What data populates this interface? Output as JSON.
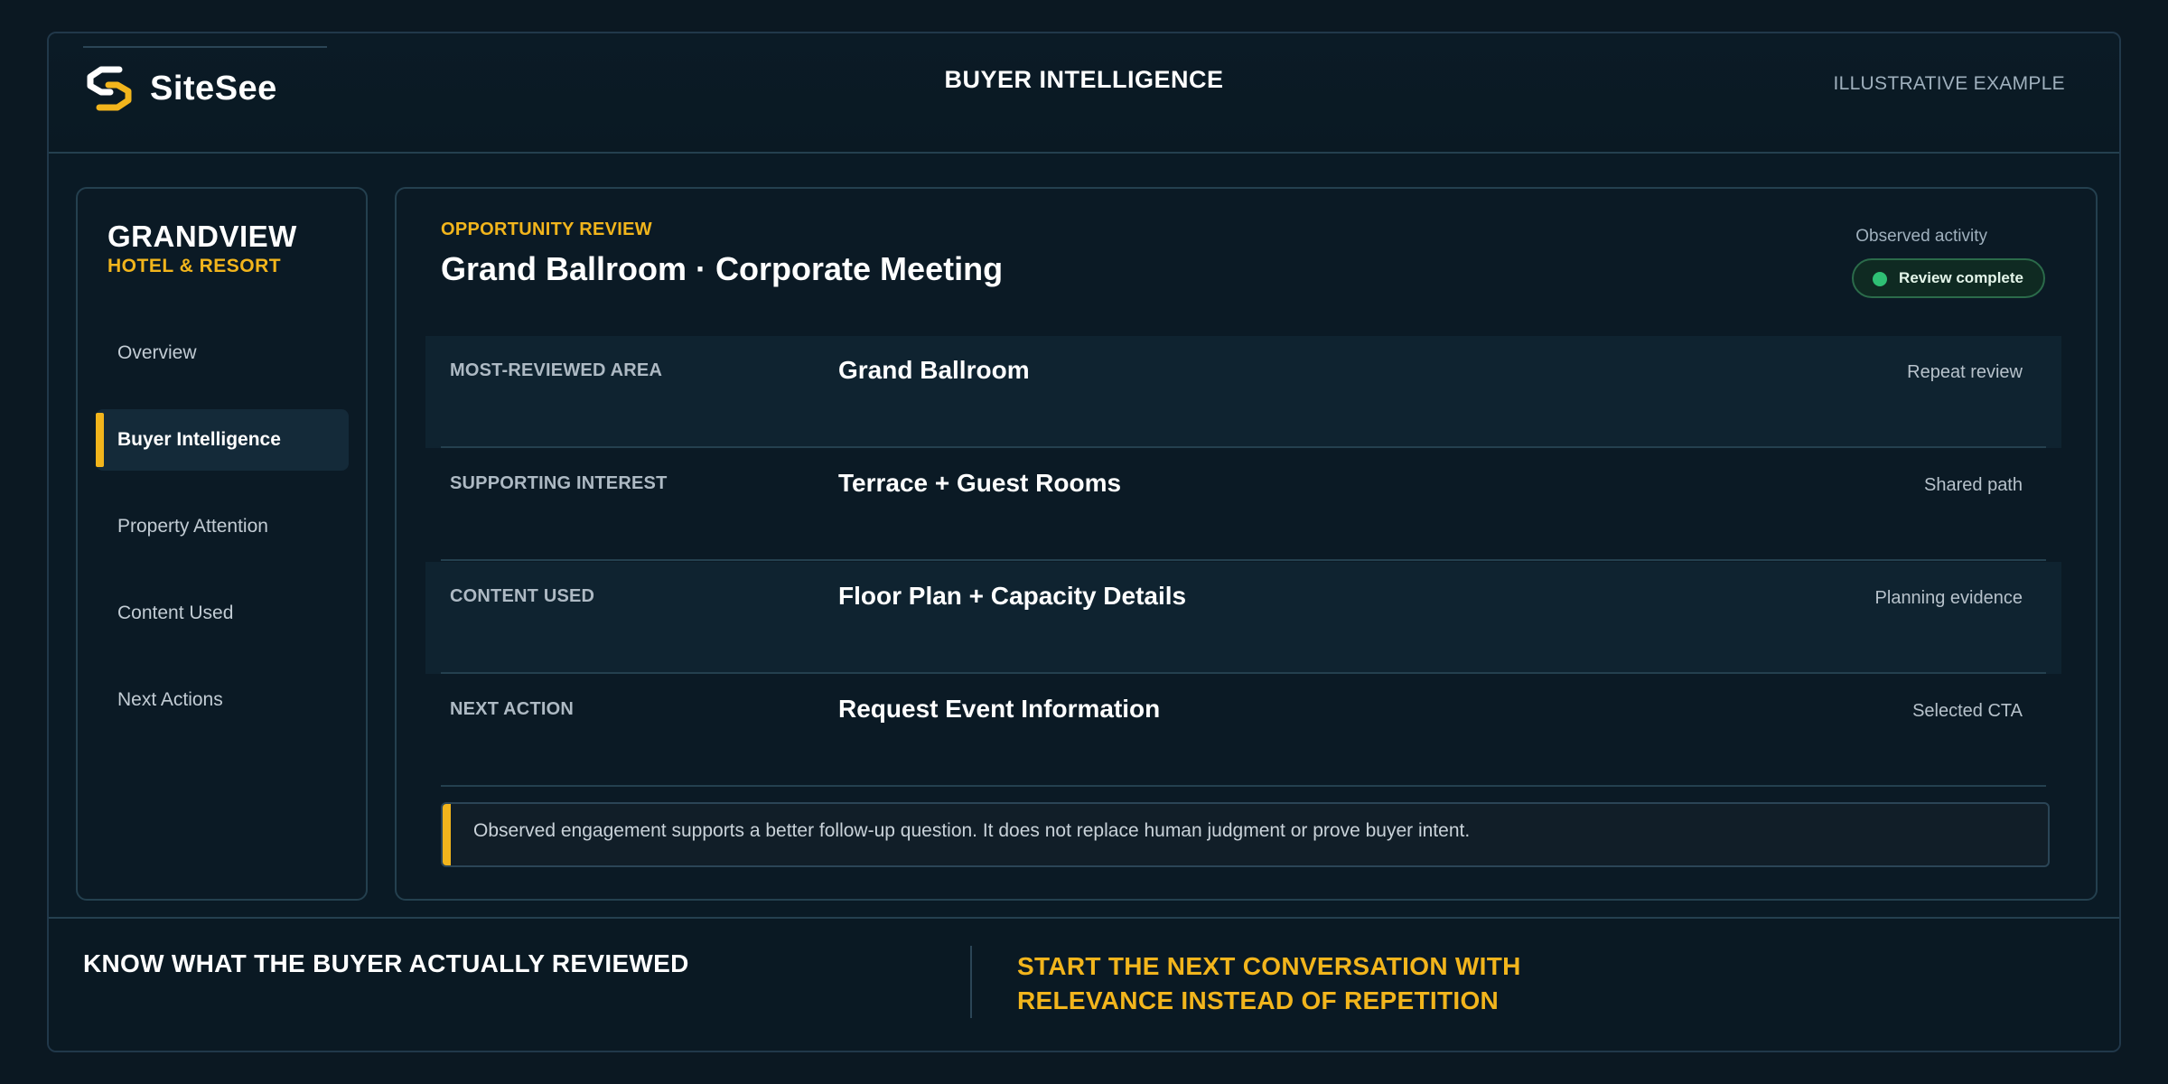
{
  "header": {
    "logo_text": "SiteSee",
    "title": "BUYER INTELLIGENCE",
    "tag": "ILLUSTRATIVE EXAMPLE"
  },
  "sidebar": {
    "brand_name": "GRANDVIEW",
    "brand_sub": "HOTEL & RESORT",
    "items": [
      {
        "label": "Overview",
        "active": false
      },
      {
        "label": "Buyer Intelligence",
        "active": true
      },
      {
        "label": "Property Attention",
        "active": false
      },
      {
        "label": "Content Used",
        "active": false
      },
      {
        "label": "Next Actions",
        "active": false
      }
    ]
  },
  "main": {
    "eyebrow": "OPPORTUNITY REVIEW",
    "title": "Grand Ballroom · Corporate Meeting",
    "activity_label": "Observed activity",
    "status": "Review complete",
    "rows": [
      {
        "label": "MOST-REVIEWED AREA",
        "value": "Grand Ballroom",
        "note": "Repeat review"
      },
      {
        "label": "SUPPORTING INTEREST",
        "value": "Terrace + Guest Rooms",
        "note": "Shared path"
      },
      {
        "label": "CONTENT USED",
        "value": "Floor Plan + Capacity Details",
        "note": "Planning evidence"
      },
      {
        "label": "NEXT ACTION",
        "value": "Request Event Information",
        "note": "Selected CTA"
      }
    ],
    "disclaimer": "Observed engagement supports a better follow-up question. It does not replace human judgment or prove buyer intent."
  },
  "footer": {
    "left": "KNOW WHAT THE BUYER ACTUALLY REVIEWED",
    "right_line1": "START THE NEXT CONVERSATION WITH",
    "right_line2": "RELEVANCE INSTEAD OF REPETITION"
  },
  "colors": {
    "accent": "#f2b51c",
    "background": "#0b1822",
    "panel": "#0b1a25",
    "status_green": "#2fbf74"
  }
}
